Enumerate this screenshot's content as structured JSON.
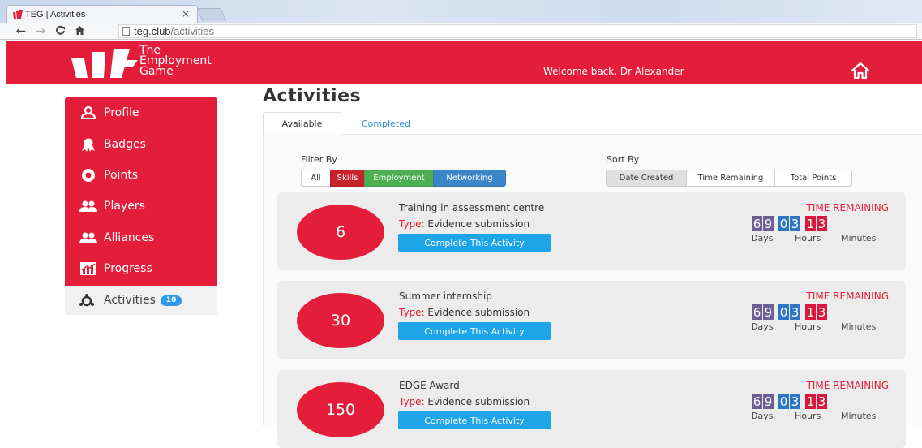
{
  "browser": {
    "tab_title": "TEG | Activities",
    "tab_close": "×",
    "url_host": "teg.club",
    "url_path": "/activities"
  },
  "header": {
    "logo_line1": "The",
    "logo_line2": "Employment",
    "logo_line3": "Game",
    "welcome": "Welcome back, Dr Alexander",
    "brand_color": "#e41d3a"
  },
  "sidebar": {
    "items": [
      {
        "label": "Profile",
        "icon": "profile-icon"
      },
      {
        "label": "Badges",
        "icon": "badge-icon"
      },
      {
        "label": "Points",
        "icon": "points-icon"
      },
      {
        "label": "Players",
        "icon": "players-icon"
      },
      {
        "label": "Alliances",
        "icon": "alliances-icon"
      },
      {
        "label": "Progress",
        "icon": "progress-icon"
      }
    ],
    "active": {
      "label": "Activities",
      "icon": "activities-icon",
      "count": "10"
    }
  },
  "main": {
    "title": "Activities",
    "tabs": [
      {
        "label": "Available"
      },
      {
        "label": "Completed"
      }
    ],
    "filter_label": "Filter By",
    "filters": [
      {
        "label": "All",
        "color": "#ffffff"
      },
      {
        "label": "Skills",
        "color": "#c8232c"
      },
      {
        "label": "Employment",
        "color": "#4caf50"
      },
      {
        "label": "Networking",
        "color": "#3a86c8"
      }
    ],
    "sort_label": "Sort By",
    "sorts": [
      {
        "label": "Date Created",
        "selected": true
      },
      {
        "label": "Time Remaining"
      },
      {
        "label": "Total Points"
      }
    ],
    "activities": [
      {
        "points": "6",
        "title": "Training in assessment centre",
        "type_label": "Type:",
        "type": " Evidence submission",
        "button": "Complete This Activity",
        "time_label": "TIME REMAINING",
        "days": [
          "6",
          "9"
        ],
        "hours": [
          "0",
          "3"
        ],
        "minutes": [
          "1",
          "3"
        ]
      },
      {
        "points": "30",
        "title": "Summer internship",
        "type_label": "Type:",
        "type": " Evidence submission",
        "button": "Complete This Activity",
        "time_label": "TIME REMAINING",
        "days": [
          "6",
          "9"
        ],
        "hours": [
          "0",
          "3"
        ],
        "minutes": [
          "1",
          "3"
        ]
      },
      {
        "points": "150",
        "title": "EDGE Award",
        "type_label": "Type:",
        "type": " Evidence submission",
        "button": "Complete This Activity",
        "time_label": "TIME REMAINING",
        "days": [
          "6",
          "9"
        ],
        "hours": [
          "0",
          "3"
        ],
        "minutes": [
          "1",
          "3"
        ]
      }
    ],
    "units": {
      "days": "Days",
      "hours": "Hours",
      "minutes": "Minutes"
    }
  }
}
